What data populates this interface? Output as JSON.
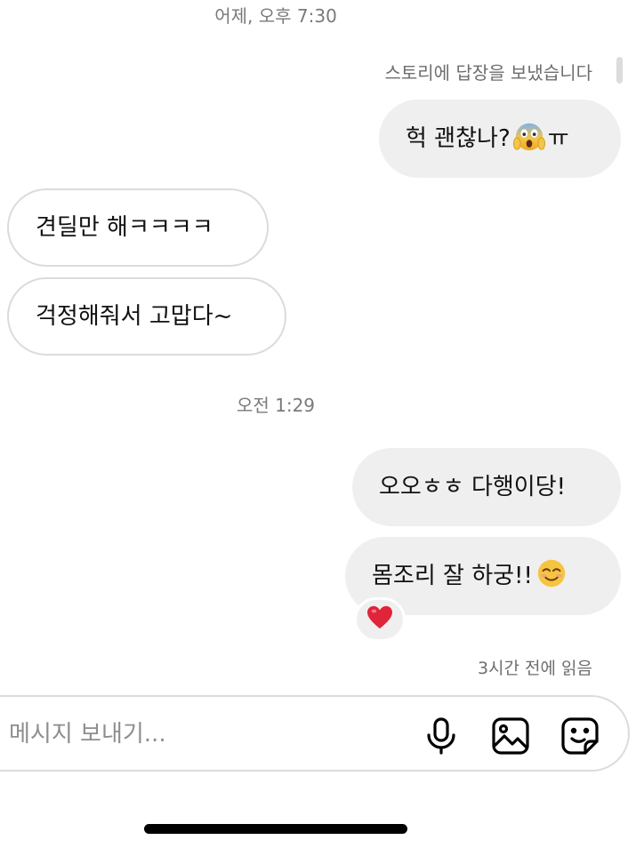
{
  "conversation": {
    "timestamps": [
      "어제, 오후 7:30",
      "오전 1:29"
    ],
    "story_reply_note": "스토리에 답장을 보냈습니다",
    "messages": [
      {
        "direction": "out",
        "text": "헉 괜찮나?",
        "emoji": "scream-face",
        "suffix": "ㅠ"
      },
      {
        "direction": "in",
        "text": "견딜만 해ㅋㅋㅋㅋ"
      },
      {
        "direction": "in",
        "text": "걱정해줘서 고맙다~"
      },
      {
        "direction": "out",
        "text": "오오ㅎㅎ 다행이당!"
      },
      {
        "direction": "out",
        "text": "몸조리 잘 하궁!!",
        "emoji": "smiling-face",
        "reaction": "red-heart"
      }
    ],
    "read_status": "3시간 전에 읽음"
  },
  "composer": {
    "placeholder": "메시지 보내기...",
    "icons": [
      "microphone-icon",
      "photo-icon",
      "sticker-icon"
    ]
  },
  "colors": {
    "outgoing_bubble": "#efefef",
    "incoming_border": "#dbdbdb",
    "meta_text": "#7a7a7a",
    "heart": "#e0243a"
  }
}
